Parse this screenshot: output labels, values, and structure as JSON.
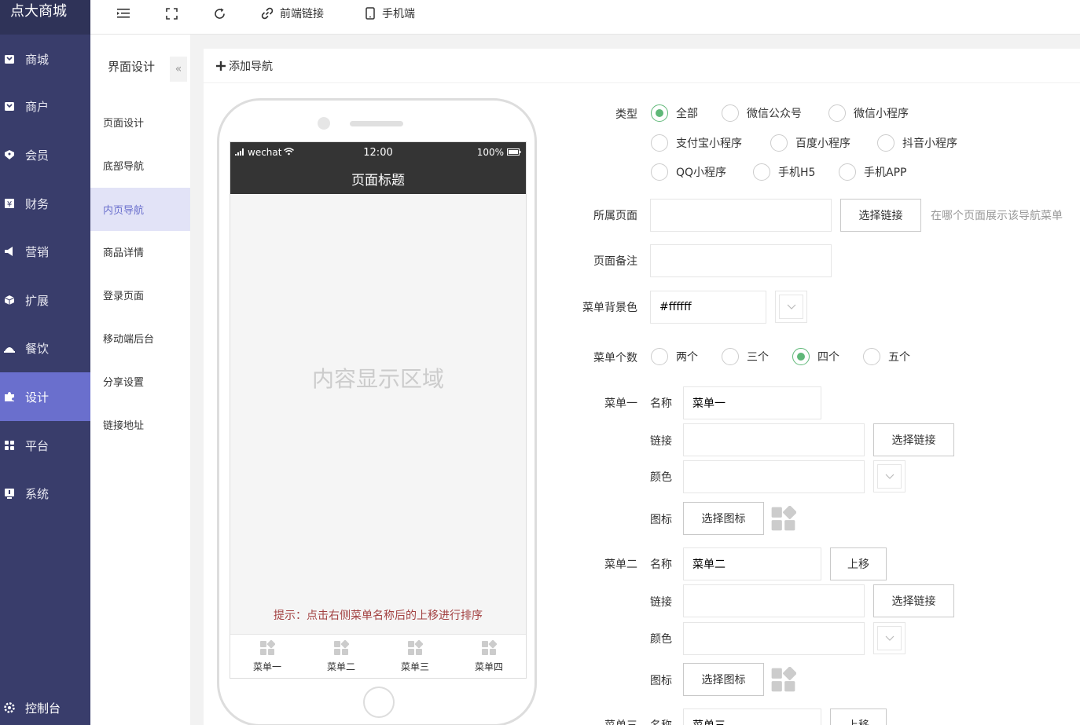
{
  "app": {
    "logo": "点大商城"
  },
  "sidebar": {
    "items": [
      {
        "label": "商城",
        "icon": "store-icon"
      },
      {
        "label": "商户",
        "icon": "merchant-icon"
      },
      {
        "label": "会员",
        "icon": "member-icon"
      },
      {
        "label": "财务",
        "icon": "finance-icon"
      },
      {
        "label": "营销",
        "icon": "megaphone-icon"
      },
      {
        "label": "扩展",
        "icon": "cube-icon"
      },
      {
        "label": "餐饮",
        "icon": "dining-icon"
      },
      {
        "label": "设计",
        "icon": "puzzle-icon"
      },
      {
        "label": "平台",
        "icon": "grid-icon"
      },
      {
        "label": "系统",
        "icon": "system-icon"
      }
    ],
    "active": "设计",
    "footer": "控制台"
  },
  "topbar": {
    "frontend_link": "前端链接",
    "mobile": "手机端"
  },
  "subsidebar": {
    "title": "界面设计",
    "collapse": "«",
    "items": [
      "页面设计",
      "底部导航",
      "内页导航",
      "商品详情",
      "登录页面",
      "移动端后台",
      "分享设置",
      "链接地址"
    ],
    "active": "内页导航"
  },
  "main": {
    "add_nav": "添加导航"
  },
  "phone": {
    "carrier": "wechat",
    "time": "12:00",
    "battery": "100%",
    "page_title": "页面标题",
    "content_label": "内容显示区域",
    "tip": "提示：点击右侧菜单名称后的上移进行排序",
    "tabs": [
      "菜单一",
      "菜单二",
      "菜单三",
      "菜单四"
    ]
  },
  "form": {
    "type_label": "类型",
    "type_options": [
      "全部",
      "微信公众号",
      "微信小程序",
      "支付宝小程序",
      "百度小程序",
      "抖音小程序",
      "QQ小程序",
      "手机H5",
      "手机APP"
    ],
    "type_selected": "全部",
    "page_label": "所属页面",
    "page_value": "",
    "select_link": "选择链接",
    "page_hint": "在哪个页面展示该导航菜单",
    "remark_label": "页面备注",
    "remark_value": "",
    "bg_label": "菜单背景色",
    "bg_value": "#ffffff",
    "count_label": "菜单个数",
    "count_options": [
      "两个",
      "三个",
      "四个",
      "五个"
    ],
    "count_selected": "四个",
    "name_label": "名称",
    "link_label": "链接",
    "color_label": "颜色",
    "icon_label": "图标",
    "select_icon": "选择图标",
    "move_up": "上移",
    "menus": [
      {
        "title": "菜单一",
        "name": "菜单一"
      },
      {
        "title": "菜单二",
        "name": "菜单二"
      },
      {
        "title": "菜单三",
        "name": "菜单三"
      }
    ]
  }
}
